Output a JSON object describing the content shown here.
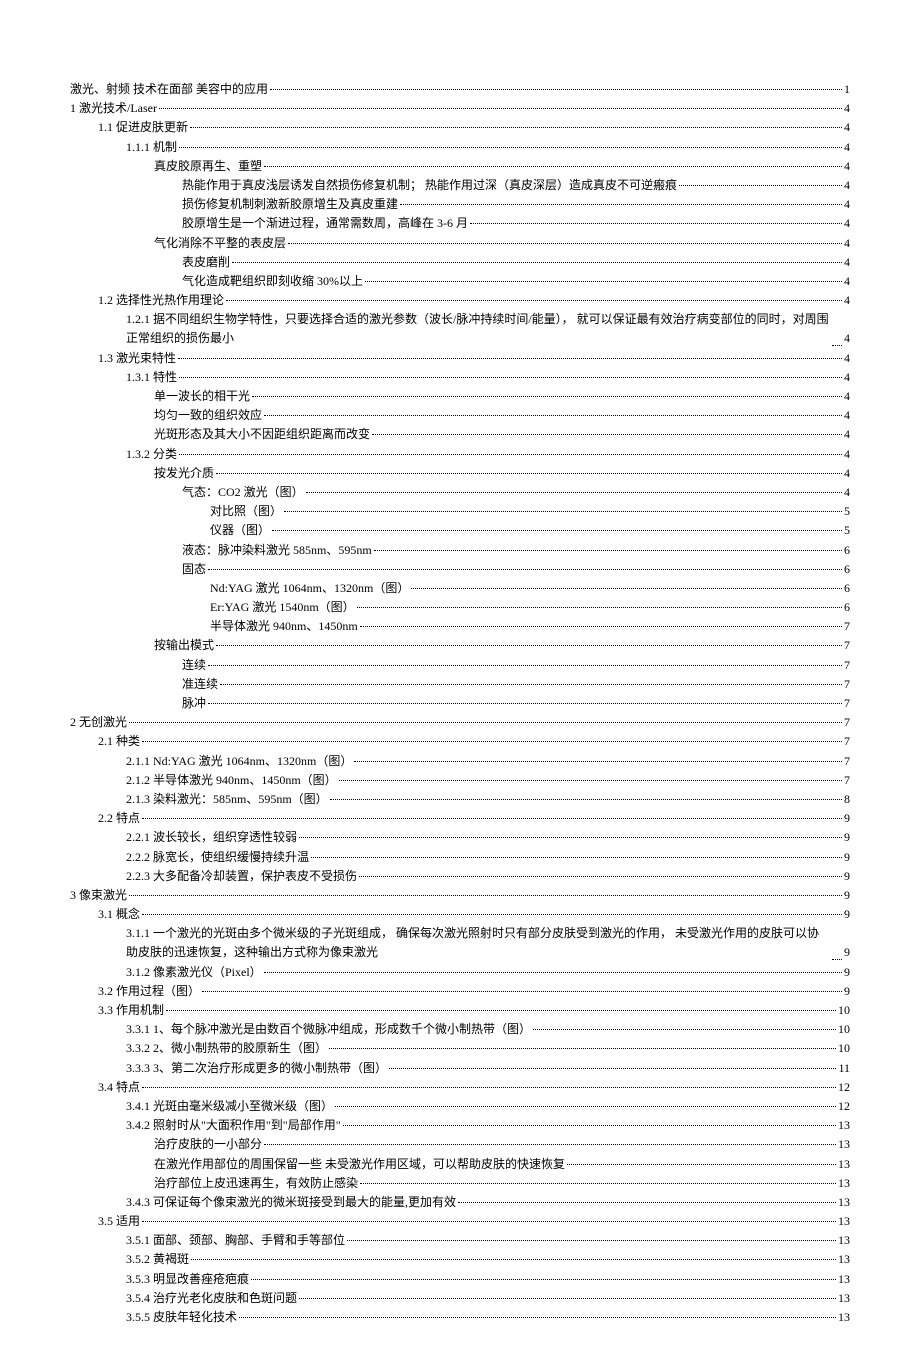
{
  "toc": [
    {
      "level": 0,
      "text": "激光、射频 技术在面部 美容中的应用",
      "page": "1"
    },
    {
      "level": 0,
      "text": "1 激光技术/Laser",
      "page": "4"
    },
    {
      "level": 1,
      "text": "1.1 促进皮肤更新",
      "page": "4"
    },
    {
      "level": 2,
      "text": "1.1.1 机制",
      "page": "4"
    },
    {
      "level": 3,
      "text": "真皮胶原再生、重塑",
      "page": "4"
    },
    {
      "level": 4,
      "text": "热能作用于真皮浅层诱发自然损伤修复机制； 热能作用过深（真皮深层）造成真皮不可逆瘢痕",
      "page": "4"
    },
    {
      "level": 4,
      "text": "损伤修复机制刺激新胶原增生及真皮重建",
      "page": "4"
    },
    {
      "level": 4,
      "text": "胶原增生是一个渐进过程，通常需数周，高峰在 3-6 月",
      "page": "4"
    },
    {
      "level": 3,
      "text": "气化消除不平整的表皮层",
      "page": "4"
    },
    {
      "level": 4,
      "text": "表皮磨削",
      "page": "4"
    },
    {
      "level": 4,
      "text": "气化造成靶组织即刻收缩 30%以上",
      "page": "4"
    },
    {
      "level": 1,
      "text": "1.2 选择性光热作用理论",
      "page": "4"
    },
    {
      "level": 2,
      "text": "1.2.1 据不同组织生物学特性，只要选择合适的激光参数（波长/脉冲持续时间/能量）， 就可以保证最有效治疗病变部位的同时，对周围正常组织的损伤最小",
      "page": "4",
      "wrap": true
    },
    {
      "level": 1,
      "text": "1.3 激光束特性",
      "page": "4"
    },
    {
      "level": 2,
      "text": "1.3.1 特性",
      "page": "4"
    },
    {
      "level": 3,
      "text": "单一波长的相干光",
      "page": "4"
    },
    {
      "level": 3,
      "text": "均匀一致的组织效应",
      "page": "4"
    },
    {
      "level": 3,
      "text": "光斑形态及其大小不因距组织距离而改变",
      "page": "4"
    },
    {
      "level": 2,
      "text": "1.3.2 分类",
      "page": "4"
    },
    {
      "level": 3,
      "text": "按发光介质",
      "page": "4"
    },
    {
      "level": 4,
      "text": "气态：CO2 激光（图）",
      "page": "4"
    },
    {
      "level": 5,
      "text": "对比照（图）",
      "page": "5"
    },
    {
      "level": 5,
      "text": "仪器（图）",
      "page": "5"
    },
    {
      "level": 4,
      "text": "液态：脉冲染料激光 585nm、595nm",
      "page": "6"
    },
    {
      "level": 4,
      "text": "固态",
      "page": "6"
    },
    {
      "level": 5,
      "text": "Nd:YAG 激光 1064nm、1320nm（图）",
      "page": "6"
    },
    {
      "level": 5,
      "text": "Er:YAG 激光 1540nm（图）",
      "page": "6"
    },
    {
      "level": 5,
      "text": "半导体激光 940nm、1450nm",
      "page": "7"
    },
    {
      "level": 3,
      "text": "按输出模式",
      "page": "7"
    },
    {
      "level": 4,
      "text": "连续",
      "page": "7"
    },
    {
      "level": 4,
      "text": "准连续",
      "page": "7"
    },
    {
      "level": 4,
      "text": "脉冲",
      "page": "7"
    },
    {
      "level": 0,
      "text": "2 无创激光",
      "page": "7"
    },
    {
      "level": 1,
      "text": "2.1 种类",
      "page": "7"
    },
    {
      "level": 2,
      "text": "2.1.1 Nd:YAG 激光 1064nm、1320nm（图）",
      "page": "7"
    },
    {
      "level": 2,
      "text": "2.1.2 半导体激光 940nm、1450nm（图）",
      "page": "7"
    },
    {
      "level": 2,
      "text": "2.1.3 染料激光：585nm、595nm（图）",
      "page": "8"
    },
    {
      "level": 1,
      "text": "2.2 特点",
      "page": "9"
    },
    {
      "level": 2,
      "text": "2.2.1 波长较长，组织穿透性较弱",
      "page": "9"
    },
    {
      "level": 2,
      "text": "2.2.2 脉宽长，使组织缓慢持续升温",
      "page": "9"
    },
    {
      "level": 2,
      "text": "2.2.3 大多配备冷却装置，保护表皮不受损伤",
      "page": "9"
    },
    {
      "level": 0,
      "text": "3 像束激光",
      "page": "9"
    },
    {
      "level": 1,
      "text": "3.1 概念",
      "page": "9"
    },
    {
      "level": 2,
      "text": "3.1.1 一个激光的光斑由多个微米级的子光斑组成， 确保每次激光照射时只有部分皮肤受到激光的作用， 未受激光作用的皮肤可以协助皮肤的迅速恢复，这种输出方式称为像束激光",
      "page": "9",
      "wrap": true
    },
    {
      "level": 2,
      "text": "3.1.2 像素激光仪（Pixel）",
      "page": "9"
    },
    {
      "level": 1,
      "text": "3.2 作用过程（图）",
      "page": "9"
    },
    {
      "level": 1,
      "text": "3.3 作用机制",
      "page": "10"
    },
    {
      "level": 2,
      "text": "3.3.1 1、每个脉冲激光是由数百个微脉冲组成，形成数千个微小制热带（图）",
      "page": "10"
    },
    {
      "level": 2,
      "text": "3.3.2 2、微小制热带的胶原新生（图）",
      "page": "10"
    },
    {
      "level": 2,
      "text": "3.3.3 3、第二次治疗形成更多的微小制热带（图）",
      "page": "11"
    },
    {
      "level": 1,
      "text": "3.4 特点",
      "page": "12"
    },
    {
      "level": 2,
      "text": "3.4.1 光斑由毫米级减小至微米级（图）",
      "page": "12"
    },
    {
      "level": 2,
      "text": "3.4.2 照射时从\"大面积作用\"到\"局部作用\"",
      "page": "13"
    },
    {
      "level": 3,
      "text": "治疗皮肤的一小部分",
      "page": "13"
    },
    {
      "level": 3,
      "text": "在激光作用部位的周围保留一些 未受激光作用区域，可以帮助皮肤的快速恢复",
      "page": "13"
    },
    {
      "level": 3,
      "text": "治疗部位上皮迅速再生，有效防止感染",
      "page": "13"
    },
    {
      "level": 2,
      "text": "3.4.3 可保证每个像束激光的微米斑接受到最大的能量,更加有效",
      "page": "13"
    },
    {
      "level": 1,
      "text": "3.5 适用",
      "page": "13"
    },
    {
      "level": 2,
      "text": "3.5.1 面部、颈部、胸部、手臂和手等部位",
      "page": "13"
    },
    {
      "level": 2,
      "text": "3.5.2 黄褐斑",
      "page": "13"
    },
    {
      "level": 2,
      "text": "3.5.3 明显改善痤疮疤痕",
      "page": "13"
    },
    {
      "level": 2,
      "text": "3.5.4 治疗光老化皮肤和色斑问题",
      "page": "13"
    },
    {
      "level": 2,
      "text": "3.5.5 皮肤年轻化技术",
      "page": "13"
    }
  ]
}
